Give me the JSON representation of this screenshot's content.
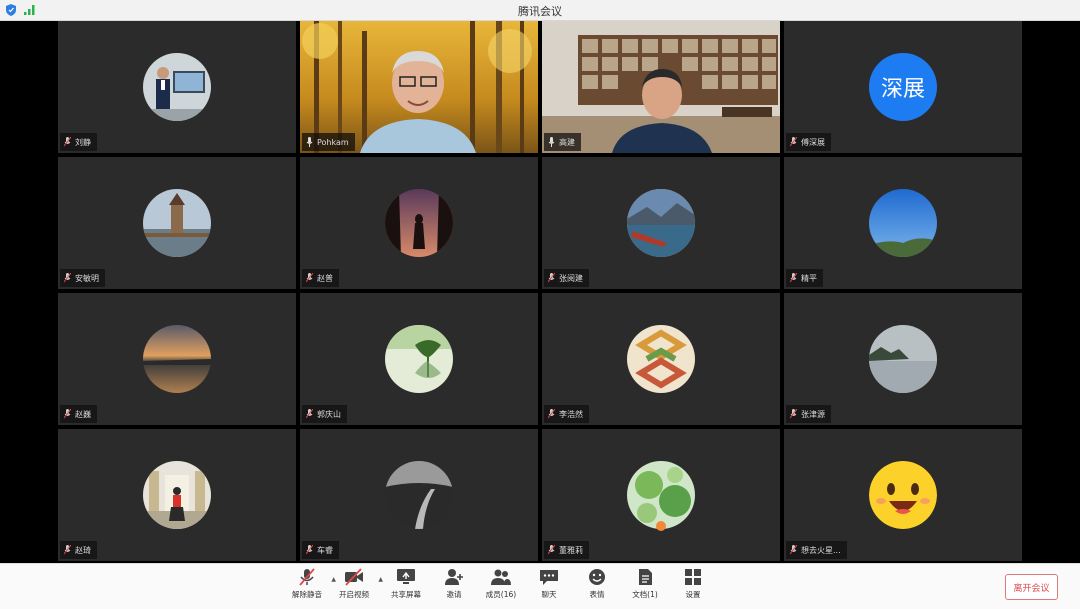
{
  "window": {
    "title": "腾讯会议"
  },
  "participants": [
    {
      "name": "刘静",
      "avatar": "presenter-photo"
    },
    {
      "name": "Pohkam",
      "avatar": "video-feed-forest"
    },
    {
      "name": "高建",
      "avatar": "video-feed-library"
    },
    {
      "name": "傅深展",
      "avatar": "text-avatar",
      "avatar_text": "深展",
      "avatar_color": "#1e7cf2"
    },
    {
      "name": "安敏明",
      "avatar": "tower-photo"
    },
    {
      "name": "赵普",
      "avatar": "silhouette-photo"
    },
    {
      "name": "张阅建",
      "avatar": "lake-boat-photo"
    },
    {
      "name": "精平",
      "avatar": "blue-sky-photo"
    },
    {
      "name": "赵巍",
      "avatar": "sunset-photo"
    },
    {
      "name": "郭庆山",
      "avatar": "tree-reflection-photo"
    },
    {
      "name": "李浩然",
      "avatar": "pattern-logo"
    },
    {
      "name": "张津源",
      "avatar": "misty-island-photo"
    },
    {
      "name": "赵琦",
      "avatar": "building-photo"
    },
    {
      "name": "车睿",
      "avatar": "dark-road-photo"
    },
    {
      "name": "董雅莉",
      "avatar": "lotus-leaf-photo"
    },
    {
      "name": "想去火星...",
      "avatar": "smiley-emoji"
    }
  ],
  "toolbar": {
    "unmute": "解除静音",
    "start_video": "开启视频",
    "share_screen": "共享屏幕",
    "invite": "邀请",
    "members": "成员(16)",
    "chat": "聊天",
    "reactions": "表情",
    "documents": "文档(1)",
    "settings": "设置",
    "leave": "离开会议"
  },
  "colors": {
    "accent": "#1e7cf2",
    "leave": "#d94c4c",
    "tile_bg": "#2b2b2b"
  }
}
